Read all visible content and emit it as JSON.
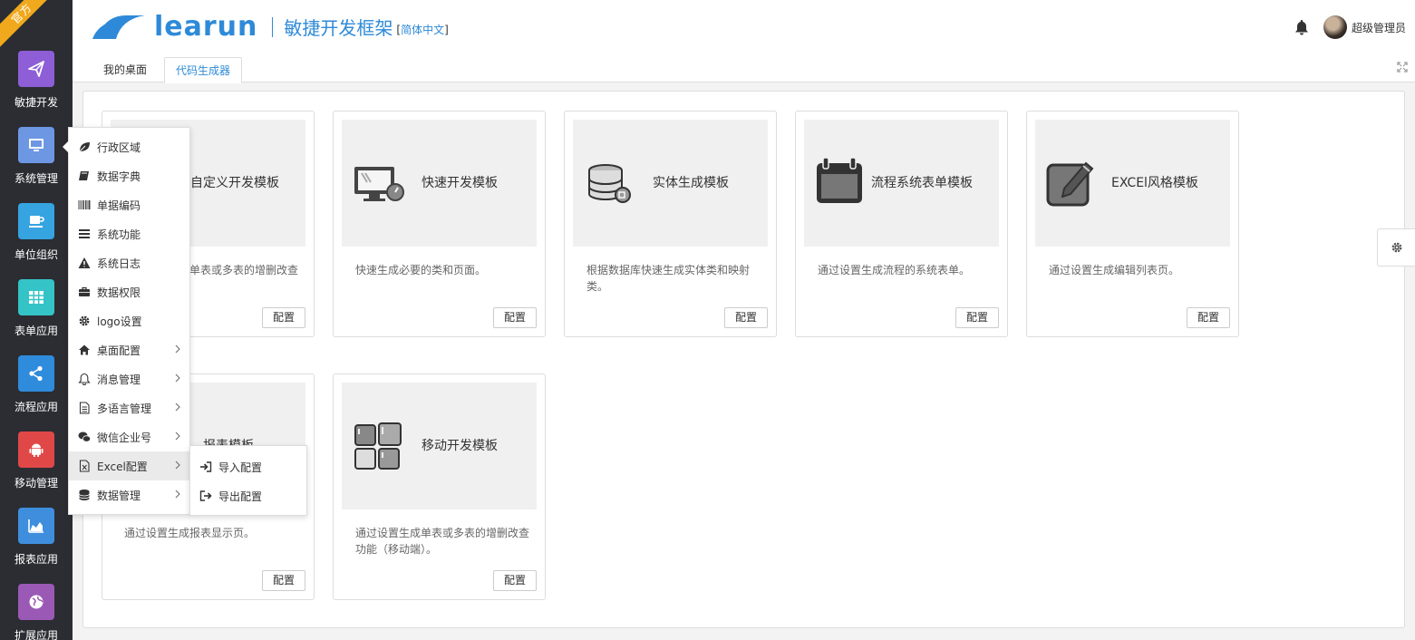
{
  "sidebar": {
    "badge": "官方",
    "items": [
      {
        "label": "敏捷开发",
        "color": "#8e5ed6"
      },
      {
        "label": "系统管理",
        "color": "#6d97e3"
      },
      {
        "label": "单位组织",
        "color": "#35a4e0"
      },
      {
        "label": "表单应用",
        "color": "#34c3c7"
      },
      {
        "label": "流程应用",
        "color": "#2f8bdb"
      },
      {
        "label": "移动管理",
        "color": "#e04848"
      },
      {
        "label": "报表应用",
        "color": "#3f8ede"
      },
      {
        "label": "扩展应用",
        "color": "#9b59b6"
      }
    ]
  },
  "header": {
    "brand": "learun",
    "subtitle": "敏捷开发框架",
    "lang_open": "[",
    "lang": "简体中文",
    "lang_close": "]",
    "user": "超级管理员",
    "brand_color": "#2e8ad8"
  },
  "tabs": [
    {
      "label": "我的桌面"
    },
    {
      "label": "代码生成器"
    }
  ],
  "cards": [
    {
      "title": "自定义开发模板",
      "desc": "通过设置生成单表或多表的增删改查功能。",
      "button": "配置"
    },
    {
      "title": "快速开发模板",
      "desc": "快速生成必要的类和页面。",
      "button": "配置"
    },
    {
      "title": "实体生成模板",
      "desc": "根据数据库快速生成实体类和映射类。",
      "button": "配置"
    },
    {
      "title": "流程系统表单模板",
      "desc": "通过设置生成流程的系统表单。",
      "button": "配置"
    },
    {
      "title": "EXCEl风格模板",
      "desc": "通过设置生成编辑列表页。",
      "button": "配置"
    },
    {
      "title": "报表模板",
      "desc": "通过设置生成报表显示页。",
      "button": "配置"
    },
    {
      "title": "移动开发模板",
      "desc": "通过设置生成单表或多表的增删改查功能（移动端）。",
      "button": "配置"
    }
  ],
  "menu": {
    "items": [
      {
        "label": "行政区域",
        "icon": "leaf-icon"
      },
      {
        "label": "数据字典",
        "icon": "book-icon"
      },
      {
        "label": "单据编码",
        "icon": "barcode-icon"
      },
      {
        "label": "系统功能",
        "icon": "list-icon"
      },
      {
        "label": "系统日志",
        "icon": "warning-icon"
      },
      {
        "label": "数据权限",
        "icon": "briefcase-icon"
      },
      {
        "label": "logo设置",
        "icon": "gear-icon"
      },
      {
        "label": "桌面配置",
        "icon": "home-icon"
      },
      {
        "label": "消息管理",
        "icon": "bell-icon"
      },
      {
        "label": "多语言管理",
        "icon": "file-icon"
      },
      {
        "label": "微信企业号",
        "icon": "wechat-icon"
      },
      {
        "label": "Excel配置",
        "icon": "excel-icon"
      },
      {
        "label": "数据管理",
        "icon": "database-icon"
      }
    ],
    "submenu": [
      {
        "label": "导入配置",
        "icon": "sign-in-icon"
      },
      {
        "label": "导出配置",
        "icon": "sign-out-icon"
      }
    ]
  }
}
